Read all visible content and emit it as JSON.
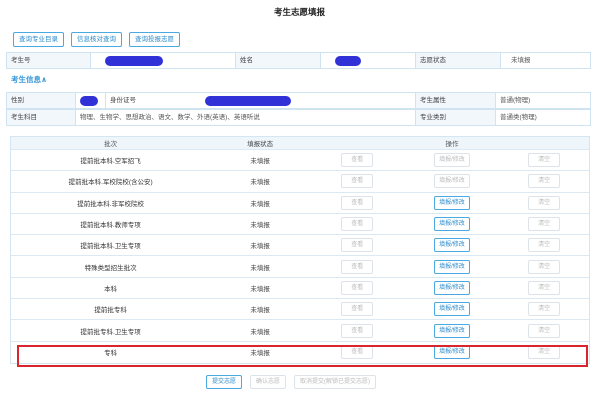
{
  "page_title": "考生志愿填报",
  "top_buttons": [
    "查询专业目录",
    "信息核对查询",
    "查询投报志愿"
  ],
  "info1": {
    "id_label": "考生号",
    "name_label": "姓名",
    "status_label": "志愿状态",
    "status_value": "未填报"
  },
  "section_title": "考生信息∧",
  "info2": {
    "gender_label": "性别",
    "idcard_label": "身份证号",
    "attr_label": "考生属性",
    "attr_value": "普通(物理)",
    "subject_label": "考生科目",
    "subject_value": "物理、生物学、思想政治、语文、数学、外语(英语)、英语听说",
    "major_label": "专业类别",
    "major_value": "普通类(物理)"
  },
  "table": {
    "headers": [
      "批次",
      "填报状态",
      "操作"
    ],
    "rows": [
      {
        "batch": "提前批本科.空军招飞",
        "status": "未填报",
        "view": "查看",
        "edit": "填报/修改",
        "clear": "清空",
        "edit_enabled": false
      },
      {
        "batch": "提前批本科.军校院校(含公安)",
        "status": "未填报",
        "view": "查看",
        "edit": "填报/修改",
        "clear": "清空",
        "edit_enabled": false
      },
      {
        "batch": "提前批本科.非军校院校",
        "status": "未填报",
        "view": "查看",
        "edit": "填报/修改",
        "clear": "清空",
        "edit_enabled": true
      },
      {
        "batch": "提前批本科.教师专项",
        "status": "未填报",
        "view": "查看",
        "edit": "填报/修改",
        "clear": "清空",
        "edit_enabled": true
      },
      {
        "batch": "提前批本科.卫生专项",
        "status": "未填报",
        "view": "查看",
        "edit": "填报/修改",
        "clear": "清空",
        "edit_enabled": true
      },
      {
        "batch": "特殊类型招生批次",
        "status": "未填报",
        "view": "查看",
        "edit": "填报/修改",
        "clear": "清空",
        "edit_enabled": true
      },
      {
        "batch": "本科",
        "status": "未填报",
        "view": "查看",
        "edit": "填报/修改",
        "clear": "清空",
        "edit_enabled": true
      },
      {
        "batch": "提前批专科",
        "status": "未填报",
        "view": "查看",
        "edit": "填报/修改",
        "clear": "清空",
        "edit_enabled": true
      },
      {
        "batch": "提前批专科.卫生专项",
        "status": "未填报",
        "view": "查看",
        "edit": "填报/修改",
        "clear": "清空",
        "edit_enabled": true
      },
      {
        "batch": "专科",
        "status": "未填报",
        "view": "查看",
        "edit": "填报/修改",
        "clear": "清空",
        "edit_enabled": true
      }
    ]
  },
  "bottom_buttons": [
    "提交志愿",
    "确认志愿",
    "取消提交(解锁已提交志愿)"
  ],
  "colors": {
    "accent": "#2d8ccb",
    "redact": "#3131d8",
    "highlight": "#d9252e"
  }
}
